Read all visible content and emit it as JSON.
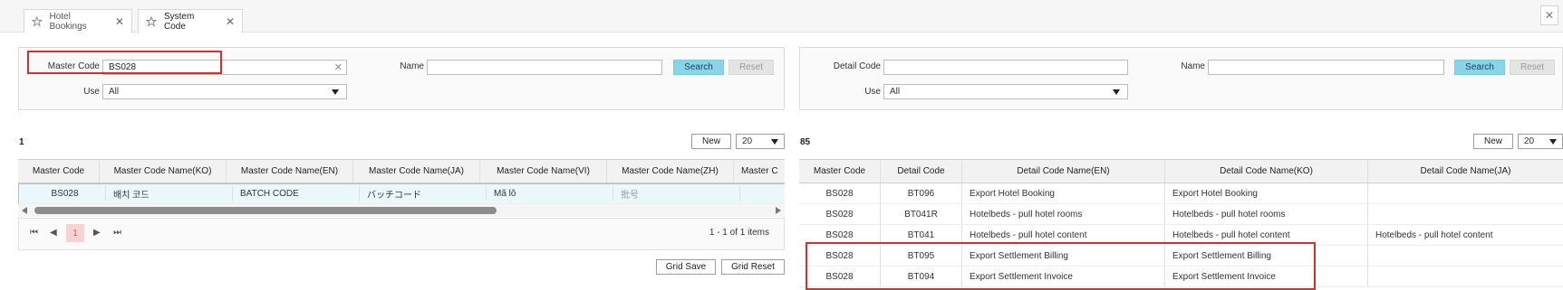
{
  "tabs": [
    {
      "label": "Hotel Bookings",
      "icon": "star-icon",
      "close": "✕"
    },
    {
      "label": "System Code",
      "icon": "star-icon",
      "close": "✕"
    }
  ],
  "close_all": "✕",
  "left": {
    "filters": {
      "master_code_label": "Master Code",
      "master_code_value": "BS028",
      "clear": "✕",
      "name_label": "Name",
      "name_value": "",
      "use_label": "Use",
      "use_value": "All",
      "search": "Search",
      "reset": "Reset"
    },
    "count": "1",
    "new": "New",
    "page_size": "20",
    "columns": [
      "Master Code",
      "Master Code Name(KO)",
      "Master Code Name(EN)",
      "Master Code Name(JA)",
      "Master Code Name(VI)",
      "Master Code Name(ZH)",
      "Master C"
    ],
    "rows": [
      [
        "BS028",
        "배치 코드",
        "BATCH CODE",
        "バッチコード",
        "Mã lô",
        "批号",
        ""
      ]
    ],
    "pager": {
      "first": "⏮",
      "prev": "◀",
      "current": "1",
      "next": "▶",
      "last": "⏭",
      "info": "1 - 1 of 1 items"
    },
    "grid_save": "Grid Save",
    "grid_reset": "Grid Reset"
  },
  "right": {
    "filters": {
      "detail_code_label": "Detail Code",
      "detail_code_value": "",
      "name_label": "Name",
      "name_value": "",
      "use_label": "Use",
      "use_value": "All",
      "search": "Search",
      "reset": "Reset"
    },
    "count": "85",
    "new": "New",
    "page_size": "20",
    "columns": [
      "Master Code",
      "Detail Code",
      "Detail Code Name(EN)",
      "Detail Code Name(KO)",
      "Detail Code Name(JA)"
    ],
    "rows": [
      [
        "BS028",
        "BT096",
        "Export Hotel Booking",
        "Export Hotel Booking",
        ""
      ],
      [
        "BS028",
        "BT041R",
        "Hotelbeds - pull hotel rooms",
        "Hotelbeds - pull hotel rooms",
        ""
      ],
      [
        "BS028",
        "BT041",
        "Hotelbeds - pull hotel content",
        "Hotelbeds - pull hotel content",
        "Hotelbeds - pull hotel content"
      ],
      [
        "BS028",
        "BT095",
        "Export Settlement Billing",
        "Export Settlement Billing",
        ""
      ],
      [
        "BS028",
        "BT094",
        "Export Settlement Invoice",
        "Export Settlement Invoice",
        ""
      ]
    ]
  },
  "colors": {
    "search_btn": "#8ad4ea",
    "highlight_border": "#d32f2f",
    "selected_row": "#eaf7fb",
    "current_page": "#f8d3d3"
  }
}
